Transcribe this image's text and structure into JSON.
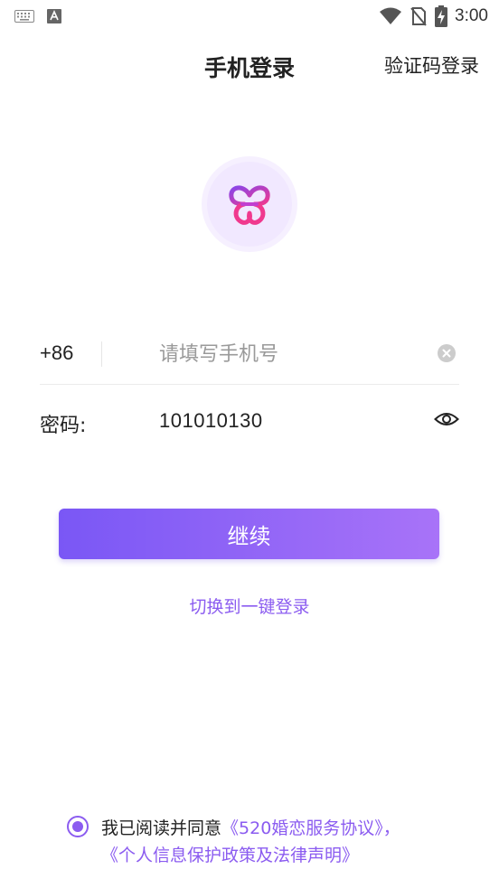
{
  "status_bar": {
    "time": "3:00",
    "icons": [
      "keyboard-icon",
      "text-a-icon",
      "wifi-icon",
      "no-sim-icon",
      "battery-charging-icon"
    ]
  },
  "header": {
    "title": "手机登录",
    "switch_label": "验证码登录"
  },
  "logo": {
    "icon": "heart-knot-logo"
  },
  "form": {
    "country_code": "+86",
    "phone_placeholder": "请填写手机号",
    "phone_value": "",
    "password_label": "密码:",
    "password_value": "101010130",
    "clear_icon": "clear-icon",
    "eye_icon": "eye-icon"
  },
  "actions": {
    "continue_label": "继续",
    "onekey_label": "切换到一键登录"
  },
  "agreement": {
    "checked": true,
    "prefix": "我已阅读并同意",
    "service_link": "《520婚恋服务协议》",
    "separator": "，",
    "privacy_link": "《个人信息保护政策及法律声明》"
  },
  "colors": {
    "accent": "#8b5cf0",
    "button_start": "#7a57f5",
    "button_end": "#a873f8",
    "logo_pink": "#f0398e",
    "logo_purple": "#8a45e8"
  }
}
